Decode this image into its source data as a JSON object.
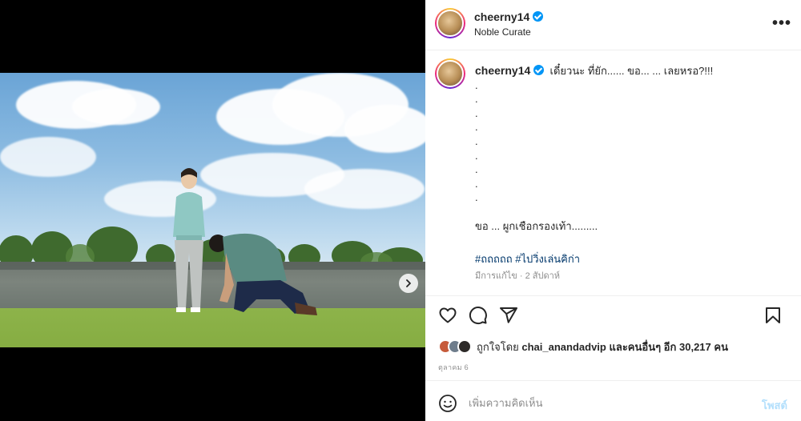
{
  "post": {
    "username": "cheerny14",
    "location": "Noble Curate",
    "more_label": "•••",
    "caption_lead": "เดี๋ยวนะ ที่ยัก...... ขอ... ... เลยหรอ?!!!",
    "caption_dots": [
      ".",
      ".",
      ".",
      ".",
      ".",
      ".",
      ".",
      ".",
      "."
    ],
    "caption_tail": "ขอ ... ผูกเชือกรองเท้า.........",
    "hashtags": [
      "#ถถถถถ",
      "#ไปวิ่งเล่นคิก่า"
    ],
    "edited_label": "มีการแก้ไข · 2 สัปดาห์"
  },
  "likes": {
    "prefix": "ถูกใจโดย",
    "user": "chai_anandadvip",
    "middle": "และคนอื่นๆ อีก",
    "count": "30,217",
    "suffix": "คน"
  },
  "date": "ตุลาคม 6",
  "comment": {
    "placeholder": "เพิ่มความคิดเห็น",
    "post_label": "โพสต์"
  },
  "carousel": {
    "slides": 2,
    "active": 1
  },
  "icons": {
    "like": "heart-icon",
    "comment": "comment-icon",
    "share": "paper-plane-icon",
    "save": "bookmark-icon",
    "emoji": "smiley-icon",
    "next": "chevron-right-icon",
    "tag": "user-tag-icon"
  },
  "colors": {
    "verified": "#0095f6",
    "link": "#00376b",
    "muted": "#8e8e8e",
    "post_disabled": "#b2dffc"
  }
}
